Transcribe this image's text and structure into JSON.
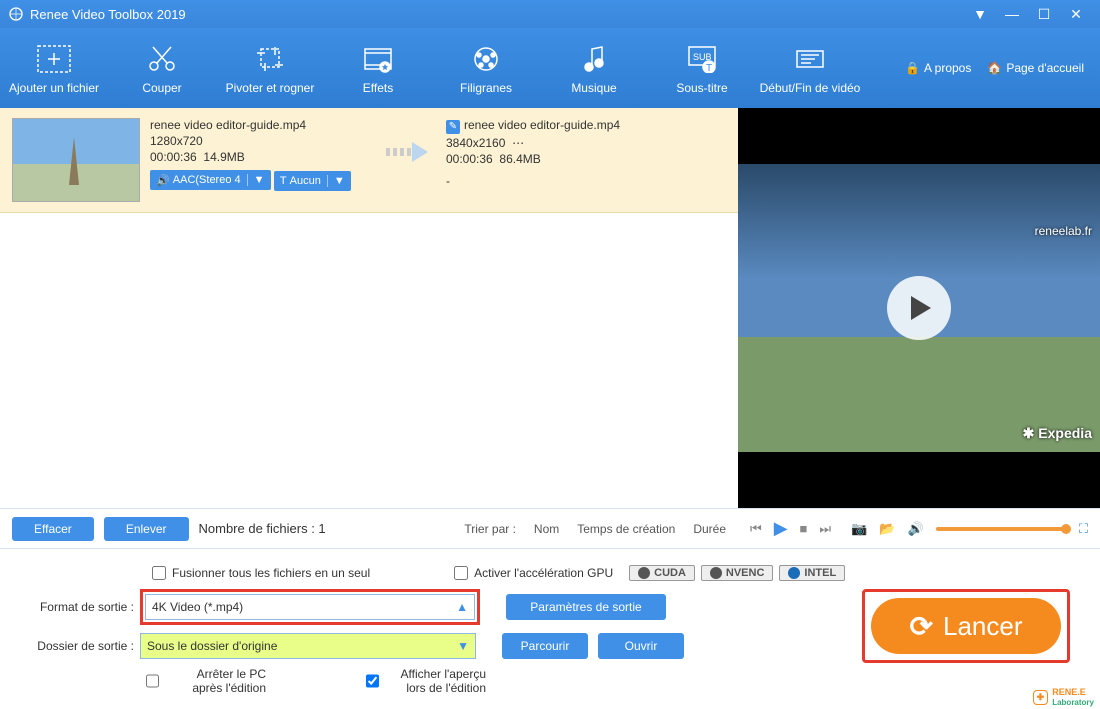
{
  "window": {
    "title": "Renee Video Toolbox 2019"
  },
  "titlebar_icons": {
    "dropdown": "▼",
    "minimize": "—",
    "maximize": "☐",
    "close": "✕"
  },
  "toolbar": {
    "items": [
      {
        "label": "Ajouter un fichier",
        "name": "add-file"
      },
      {
        "label": "Couper",
        "name": "cut"
      },
      {
        "label": "Pivoter et rogner",
        "name": "rotate-crop"
      },
      {
        "label": "Effets",
        "name": "effects"
      },
      {
        "label": "Filigranes",
        "name": "watermarks"
      },
      {
        "label": "Musique",
        "name": "music"
      },
      {
        "label": "Sous-titre",
        "name": "subtitles"
      },
      {
        "label": "Début/Fin de vidéo",
        "name": "intro-outro"
      }
    ],
    "about": "A propos",
    "home": "Page d'accueil"
  },
  "file": {
    "src": {
      "name": "renee video editor-guide.mp4",
      "resolution": "1280x720",
      "duration": "00:00:36",
      "size": "14.9MB",
      "audio_btn": "AAC(Stereo 4",
      "sub_btn": "Aucun"
    },
    "arrow_dots": "⋯",
    "dst": {
      "name": "renee video editor-guide.mp4",
      "resolution": "3840x2160",
      "resolution_suffix": "⋯",
      "duration": "00:00:36",
      "size": "86.4MB",
      "dash": "-"
    }
  },
  "preview": {
    "watermark1": "reneelab.fr",
    "watermark2": "Expedia"
  },
  "listbar": {
    "clear": "Effacer",
    "remove": "Enlever",
    "count_label": "Nombre de fichiers : 1",
    "sort_label": "Trier par :",
    "sort_name": "Nom",
    "sort_time": "Temps de création",
    "sort_dur": "Durée"
  },
  "settings": {
    "merge": "Fusionner tous les fichiers en un seul",
    "gpu": "Activer l'accélération GPU",
    "gpu_badges": [
      "CUDA",
      "NVENC",
      "INTEL"
    ],
    "format_label": "Format de sortie :",
    "format_value": "4K Video (*.mp4)",
    "format_caret": "▲",
    "params_btn": "Paramètres de sortie",
    "folder_label": "Dossier de sortie :",
    "folder_value": "Sous le dossier d'origine",
    "folder_caret": "▼",
    "browse": "Parcourir",
    "open": "Ouvrir",
    "shutdown": "Arrêter le PC après l'édition",
    "show_preview": "Afficher l'aperçu lors de l'édition",
    "launch": "Lancer"
  },
  "brand": {
    "line1": "RENE.E",
    "line2": "Laboratory"
  },
  "glyph": {
    "speaker": "🔊",
    "text_t": "T",
    "pencil": "✎",
    "prev": "⏮",
    "play": "▶",
    "stop": "■",
    "next": "⏭",
    "camera": "📷",
    "folder": "📂",
    "volume": "🔊",
    "fullscreen": "⛶",
    "lock": "🔒",
    "home": "🏠",
    "refresh": "⟳"
  }
}
